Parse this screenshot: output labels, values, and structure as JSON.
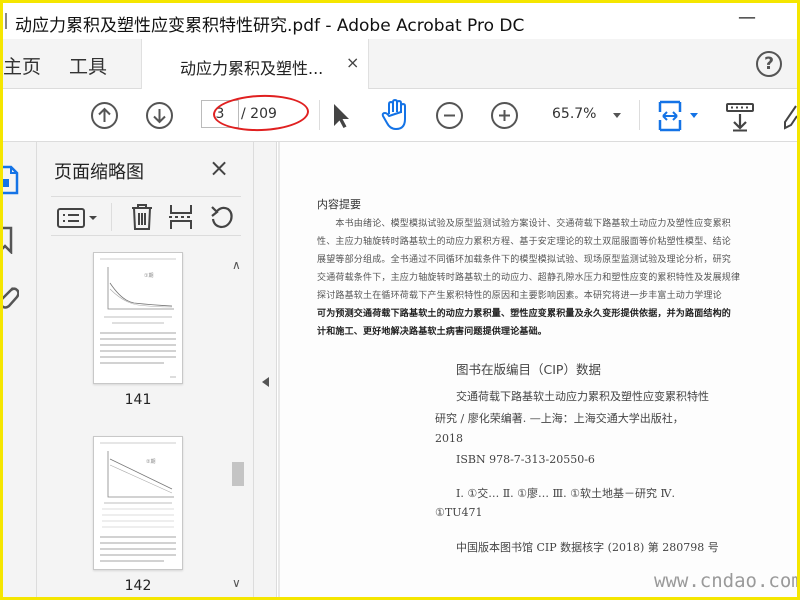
{
  "window": {
    "title": "动应力累积及塑性应变累积特性研究.pdf - Adobe Acrobat Pro DC"
  },
  "tabs": {
    "home": "主页",
    "tools": "工具",
    "document": "动应力累积及塑性...",
    "close": "×"
  },
  "toolbar": {
    "current_page": "3",
    "total_pages": "/ 209",
    "zoom": "65.7%"
  },
  "panel": {
    "title": "页面缩略图",
    "close": "×"
  },
  "thumbnails": [
    {
      "label": "141",
      "chart_caption": "①期"
    },
    {
      "label": "142",
      "chart_caption": "②期"
    }
  ],
  "document": {
    "abstract_heading": "内容提要",
    "abstract_lines": [
      "　　本书由绪论、模型模拟试验及原型监测试验方案设计、交通荷载下路基软土动应力及塑性应变累积",
      "性、主应力轴旋转时路基软土的动应力累积方程、基于安定理论的软土双屈服面等价粘塑性模型、结论",
      "展望等部分组成。全书通过不同循环加载条件下的模型模拟试验、现场原型监测试验及理论分析，研究",
      "交通荷载条件下，主应力轴旋转时路基软土的动应力、超静孔隙水压力和塑性应变的累积特性及发展规律",
      "探讨路基软土在循环荷载下产生累积特性的原因和主要影响因素。本研究将进一步丰富土动力学理论",
      "可为预测交通荷载下路基软土的动应力累积量、塑性应变累积量及永久变形提供依据，并为路面结构的",
      "计和施工、更好地解决路基软土病害问题提供理论基础。"
    ],
    "cip_title": "图书在版编目（CIP）数据",
    "cip_lines": [
      "交通荷载下路基软土动应力累积及塑性应变累积特性",
      "研究 / 廖化荣编著. —上海：上海交通大学出版社，",
      "2018",
      "ISBN 978-7-313-20550-6",
      "Ⅰ. ①交… Ⅱ. ①廖… Ⅲ. ①软土地基－研究 Ⅳ.",
      "①TU471",
      "中国版本图书馆 CIP 数据核字 (2018) 第 280798 号"
    ]
  },
  "watermark": "www.cndao.com",
  "colors": {
    "frame_border": "#f5e600",
    "accent_blue": "#1473e6",
    "highlight_red": "#e02020"
  }
}
